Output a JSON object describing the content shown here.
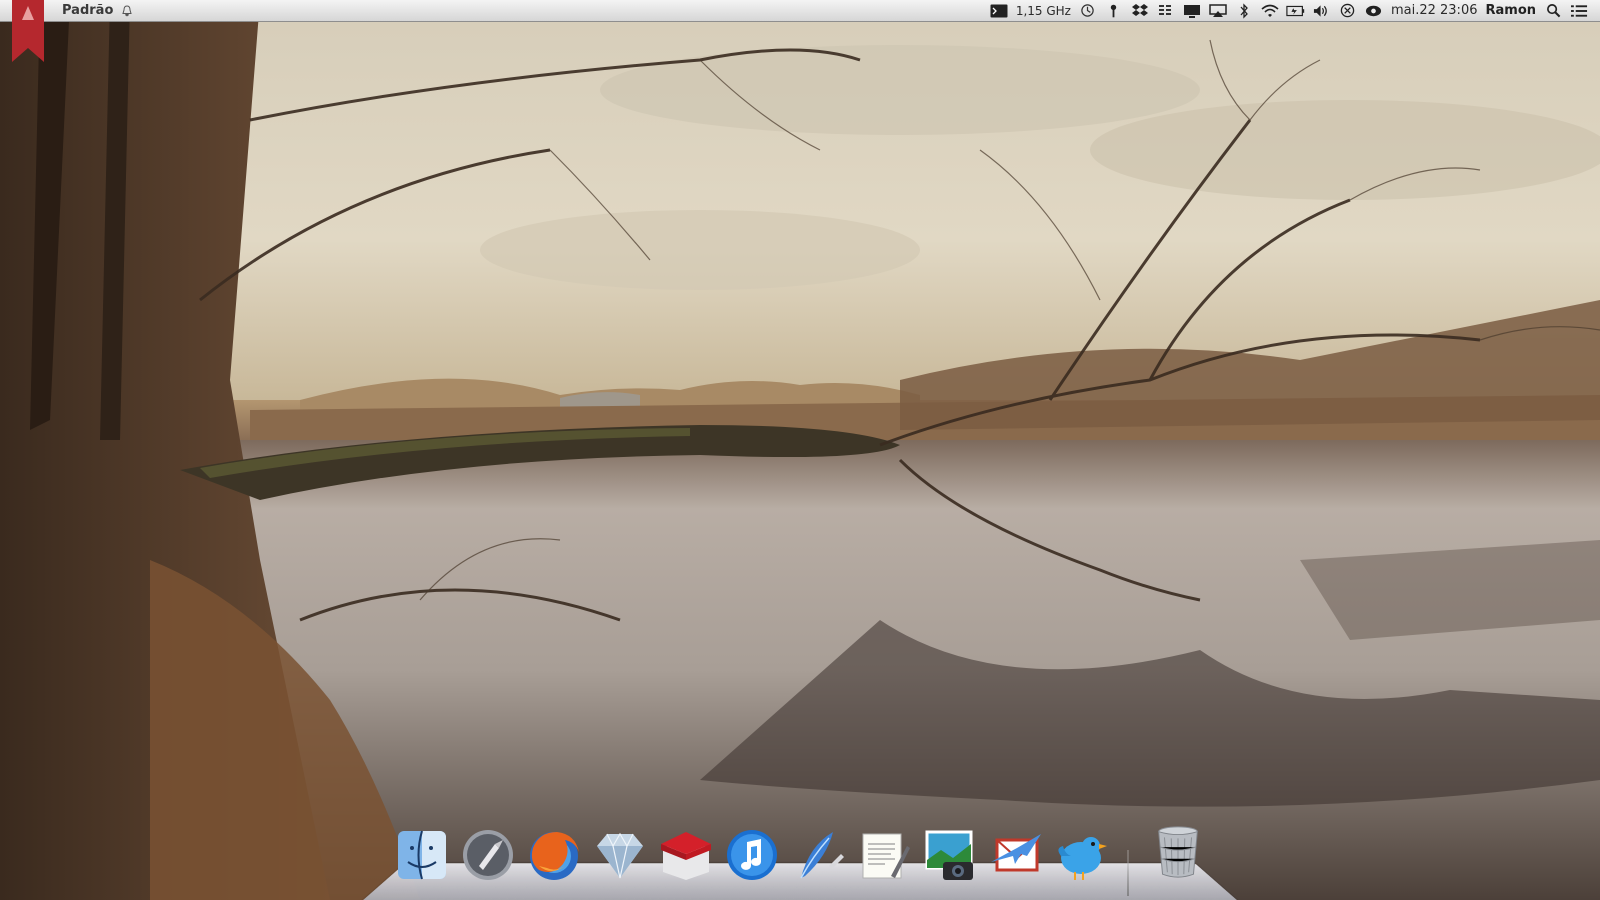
{
  "menubar": {
    "profile_label": "Padrão",
    "cpu_label": "1,15 GHz",
    "datetime": "mai.22 23:06",
    "user": "Ramon",
    "icons": [
      "terminal-icon",
      "time-machine-icon",
      "key-icon",
      "dropbox-icon",
      "menu-list-icon",
      "display-icon",
      "airplay-icon",
      "bluetooth-icon",
      "wifi-icon",
      "battery-icon",
      "volume-icon",
      "close-circle-icon",
      "eye-icon",
      "search-icon",
      "list-icon"
    ]
  },
  "dock": {
    "items": [
      {
        "name": "finder-icon"
      },
      {
        "name": "launchpad-icon"
      },
      {
        "name": "firefox-icon"
      },
      {
        "name": "sketch-diamond-icon"
      },
      {
        "name": "red-box-app-icon"
      },
      {
        "name": "itunes-icon"
      },
      {
        "name": "quill-pen-icon"
      },
      {
        "name": "textedit-icon"
      },
      {
        "name": "image-capture-icon"
      },
      {
        "name": "mail-airplane-icon"
      },
      {
        "name": "twitter-bird-icon"
      },
      {
        "name": "trash-icon"
      }
    ]
  },
  "colors": {
    "menubar_bg": "#e6e6e6",
    "bookmark_red": "#b5282e",
    "sky": "#d9d1bf",
    "water": "#a79c93"
  }
}
